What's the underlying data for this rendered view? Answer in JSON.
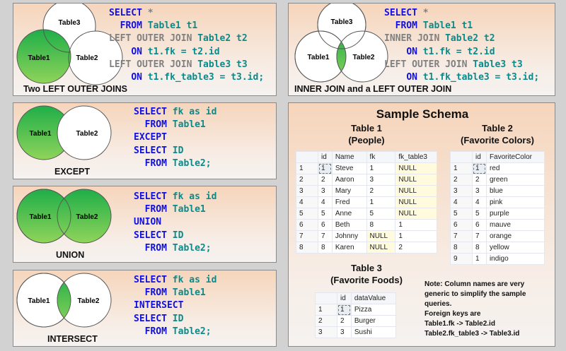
{
  "colors": {
    "green": "#2db34a",
    "keyword": "#1010e0",
    "gray": "#808080",
    "teal": "#0a8a8a"
  },
  "panels": {
    "two_left": {
      "caption": "Two LEFT OUTER JOINS",
      "labels": {
        "t1": "Table1",
        "t2": "Table2",
        "t3": "Table3"
      },
      "code": [
        [
          "SELECT",
          "*"
        ],
        [
          "FROM",
          "Table1 t1"
        ],
        [
          "LEFT OUTER JOIN",
          "Table2 t2"
        ],
        [
          "ON",
          "t1.fk = t2.id"
        ],
        [
          "LEFT OUTER JOIN",
          "Table3 t3"
        ],
        [
          "ON",
          "t1.fk_table3 = t3.id;"
        ]
      ]
    },
    "inner_left": {
      "caption": "INNER JOIN and a LEFT OUTER JOIN",
      "labels": {
        "t1": "Table1",
        "t2": "Table2",
        "t3": "Table3"
      },
      "code": [
        [
          "SELECT",
          "*"
        ],
        [
          "FROM",
          "Table1 t1"
        ],
        [
          "INNER JOIN",
          "Table2 t2"
        ],
        [
          "ON",
          "t1.fk = t2.id"
        ],
        [
          "LEFT OUTER JOIN",
          "Table3 t3"
        ],
        [
          "ON",
          "t1.fk_table3 = t3.id;"
        ]
      ]
    },
    "except": {
      "caption": "EXCEPT",
      "labels": {
        "t1": "Table1",
        "t2": "Table2"
      },
      "code": [
        [
          "SELECT",
          "fk as id"
        ],
        [
          "FROM",
          "Table1"
        ],
        [
          "EXCEPT",
          ""
        ],
        [
          "SELECT",
          "ID"
        ],
        [
          "FROM",
          "Table2;"
        ]
      ]
    },
    "union": {
      "caption": "UNION",
      "labels": {
        "t1": "Table1",
        "t2": "Table2"
      },
      "code": [
        [
          "SELECT",
          "fk as id"
        ],
        [
          "FROM",
          "Table1"
        ],
        [
          "UNION",
          ""
        ],
        [
          "SELECT",
          "ID"
        ],
        [
          "FROM",
          "Table2;"
        ]
      ]
    },
    "intersect": {
      "caption": "INTERSECT",
      "labels": {
        "t1": "Table1",
        "t2": "Table2"
      },
      "code": [
        [
          "SELECT",
          "fk as id"
        ],
        [
          "FROM",
          "Table1"
        ],
        [
          "INTERSECT",
          ""
        ],
        [
          "SELECT",
          "ID"
        ],
        [
          "FROM",
          "Table2;"
        ]
      ]
    }
  },
  "schema": {
    "title": "Sample Schema",
    "table1": {
      "title": "Table 1",
      "subtitle": "(People)",
      "headers": [
        "",
        "id",
        "Name",
        "fk",
        "fk_table3"
      ],
      "rows": [
        [
          "1",
          "1",
          "Steve",
          "1",
          "NULL"
        ],
        [
          "2",
          "2",
          "Aaron",
          "3",
          "NULL"
        ],
        [
          "3",
          "3",
          "Mary",
          "2",
          "NULL"
        ],
        [
          "4",
          "4",
          "Fred",
          "1",
          "NULL"
        ],
        [
          "5",
          "5",
          "Anne",
          "5",
          "NULL"
        ],
        [
          "6",
          "6",
          "Beth",
          "8",
          "1"
        ],
        [
          "7",
          "7",
          "Johnny",
          "NULL",
          "1"
        ],
        [
          "8",
          "8",
          "Karen",
          "NULL",
          "2"
        ]
      ]
    },
    "table2": {
      "title": "Table 2",
      "subtitle": "(Favorite Colors)",
      "headers": [
        "",
        "id",
        "FavoriteColor"
      ],
      "rows": [
        [
          "1",
          "1",
          "red"
        ],
        [
          "2",
          "2",
          "green"
        ],
        [
          "3",
          "3",
          "blue"
        ],
        [
          "4",
          "4",
          "pink"
        ],
        [
          "5",
          "5",
          "purple"
        ],
        [
          "6",
          "6",
          "mauve"
        ],
        [
          "7",
          "7",
          "orange"
        ],
        [
          "8",
          "8",
          "yellow"
        ],
        [
          "9",
          "1",
          "indigo"
        ]
      ]
    },
    "table3": {
      "title": "Table 3",
      "subtitle": "(Favorite Foods)",
      "headers": [
        "",
        "id",
        "dataValue"
      ],
      "rows": [
        [
          "1",
          "1",
          "Pizza"
        ],
        [
          "2",
          "2",
          "Burger"
        ],
        [
          "3",
          "3",
          "Sushi"
        ]
      ]
    },
    "note": [
      "Note: Column names are very",
      "generic to simplify the sample",
      "queries.",
      "Foreign keys are",
      "Table1.fk -> Table2.id",
      "Table2.fk_table3 -> Table3.id"
    ]
  }
}
